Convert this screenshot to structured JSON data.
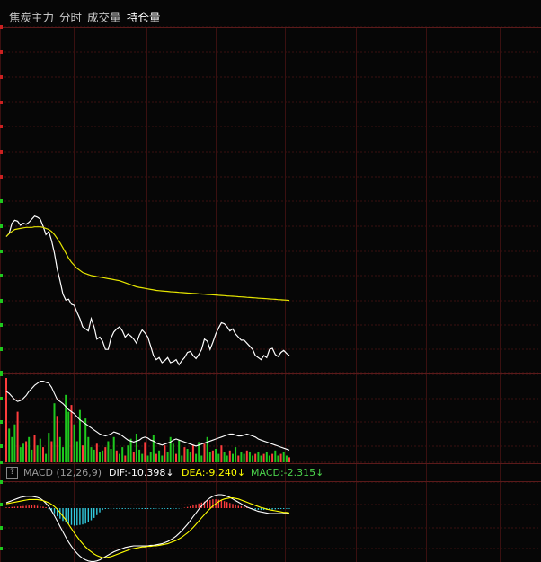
{
  "tabs": [
    {
      "label": "焦炭主力",
      "active": false
    },
    {
      "label": "分时",
      "active": false
    },
    {
      "label": "成交量",
      "active": false
    },
    {
      "label": "持仓量",
      "active": true
    }
  ],
  "macd_legend": {
    "help": "?",
    "title": "MACD (12,26,9)",
    "dif": "DIF:-10.398↓",
    "dea": "DEA:-9.240↓",
    "macd": "MACD:-2.315↓"
  },
  "colors": {
    "price": "#ffffff",
    "avg": "#e6e600",
    "up": "#ff3c3c",
    "down": "#1ec81e",
    "neg": "#32c8dc",
    "grid": "#3a1010",
    "dea": "#ffff00",
    "macd_label": "#4cd44c",
    "dea_label": "#ffff00",
    "dif_label": "#ffffff"
  },
  "chart_data": [
    {
      "type": "line",
      "panel": "price",
      "ylim": [
        0,
        100
      ],
      "series": [
        {
          "values": [
            60,
            63,
            73,
            76,
            75,
            71,
            73,
            72,
            74,
            77,
            80,
            79,
            77,
            70,
            62,
            65,
            56,
            44,
            28,
            17,
            4,
            -2,
            -1,
            -6,
            -7,
            -14,
            -20,
            -28,
            -30,
            -32,
            -20,
            -28,
            -40,
            -38,
            -42,
            -50,
            -50,
            -39,
            -33,
            -30,
            -28,
            -32,
            -38,
            -35,
            -37,
            -40,
            -44,
            -36,
            -31,
            -34,
            -38,
            -47,
            -56,
            -60,
            -58,
            -63,
            -61,
            -58,
            -63,
            -62,
            -60,
            -65,
            -61,
            -58,
            -53,
            -52,
            -56,
            -59,
            -55,
            -50,
            -40,
            -42,
            -50,
            -43,
            -35,
            -29,
            -24,
            -25,
            -28,
            -32,
            -30,
            -35,
            -38,
            -41,
            -41,
            -44,
            -47,
            -50,
            -56,
            -58,
            -60,
            -56,
            -58,
            -50,
            -49,
            -55,
            -57,
            -53,
            -51,
            -54,
            -56
          ]
        },
        {
          "values": [
            60,
            63,
            65,
            67,
            67.5,
            68,
            68.5,
            69,
            69,
            69,
            69.5,
            69.5,
            69.5,
            69,
            68,
            67,
            65,
            62,
            58,
            54,
            49,
            44,
            39,
            35,
            32,
            29,
            27,
            25,
            24,
            23,
            22,
            21.5,
            21,
            20.5,
            20,
            19.5,
            19,
            18.5,
            18,
            17.5,
            17,
            16,
            15,
            14,
            13,
            12,
            11,
            10.5,
            10,
            9.5,
            9,
            8.5,
            8,
            7.5,
            7.2,
            7,
            6.7,
            6.5,
            6.2,
            6,
            5.8,
            5.6,
            5.4,
            5.2,
            5,
            4.8,
            4.6,
            4.4,
            4.2,
            4,
            3.8,
            3.6,
            3.4,
            3.2,
            3,
            2.8,
            2.6,
            2.4,
            2.2,
            2,
            1.8,
            1.6,
            1.4,
            1.2,
            1,
            0.8,
            0.6,
            0.4,
            0.2,
            0,
            -0.2,
            -0.4,
            -0.6,
            -0.8,
            -1,
            -1.2,
            -1.4,
            -1.6,
            -1.8,
            -2,
            -2.2
          ]
        }
      ]
    },
    {
      "type": "bar",
      "panel": "volume",
      "ylim": [
        0,
        100
      ],
      "values": [
        100,
        40,
        30,
        45,
        60,
        18,
        22,
        25,
        30,
        15,
        32,
        20,
        28,
        18,
        10,
        35,
        25,
        70,
        55,
        30,
        18,
        80,
        60,
        68,
        45,
        25,
        62,
        20,
        52,
        30,
        18,
        15,
        22,
        12,
        14,
        18,
        25,
        16,
        30,
        14,
        10,
        18,
        8,
        20,
        28,
        12,
        34,
        15,
        10,
        24,
        8,
        12,
        32,
        10,
        14,
        8,
        20,
        12,
        30,
        22,
        10,
        26,
        8,
        18,
        16,
        12,
        20,
        10,
        24,
        8,
        22,
        30,
        12,
        14,
        16,
        10,
        20,
        12,
        8,
        14,
        10,
        18,
        8,
        12,
        10,
        14,
        12,
        8,
        10,
        12,
        8,
        10,
        12,
        8,
        10,
        14,
        8,
        10,
        12,
        8,
        6
      ],
      "up_flags": [
        1,
        0,
        0,
        0,
        1,
        0,
        0,
        1,
        0,
        0,
        1,
        0,
        0,
        1,
        0,
        0,
        1,
        0,
        1,
        0,
        0,
        0,
        0,
        1,
        0,
        0,
        0,
        1,
        0,
        0,
        0,
        0,
        1,
        0,
        0,
        1,
        0,
        0,
        0,
        1,
        0,
        0,
        1,
        0,
        0,
        1,
        0,
        0,
        0,
        1,
        0,
        0,
        0,
        1,
        0,
        0,
        1,
        0,
        0,
        0,
        1,
        0,
        0,
        1,
        0,
        0,
        1,
        0,
        0,
        0,
        1,
        0,
        0,
        1,
        0,
        0,
        1,
        0,
        0,
        1,
        0,
        0,
        1,
        0,
        0,
        1,
        0,
        0,
        1,
        0,
        0,
        1,
        0,
        0,
        1,
        0,
        0,
        1,
        0,
        0,
        1
      ]
    },
    {
      "type": "line",
      "panel": "open_interest",
      "ylim": [
        0,
        100
      ],
      "series": [
        {
          "values": [
            70,
            68,
            65,
            62,
            60,
            61,
            63,
            66,
            70,
            73,
            76,
            78,
            80,
            80,
            79,
            78,
            74,
            68,
            62,
            60,
            58,
            55,
            52,
            50,
            48,
            45,
            42,
            40,
            38,
            36,
            34,
            32,
            30,
            28,
            27,
            26,
            27,
            28,
            30,
            29,
            28,
            26,
            24,
            22,
            21,
            20,
            21,
            22,
            24,
            25,
            24,
            22,
            21,
            19,
            18,
            17,
            18,
            19,
            20,
            22,
            23,
            22,
            21,
            20,
            19,
            18,
            17,
            16,
            17,
            18,
            19,
            20,
            21,
            22,
            23,
            24,
            25,
            26,
            27,
            28,
            28,
            27,
            26,
            26,
            27,
            28,
            27,
            26,
            25,
            23,
            22,
            21,
            20,
            19,
            18,
            17,
            16,
            15,
            14,
            13,
            12
          ]
        }
      ]
    },
    {
      "type": "bar",
      "panel": "macd",
      "ylim": [
        -100,
        100
      ],
      "values": [
        3,
        4,
        5,
        6,
        7,
        8,
        9,
        10,
        11,
        12,
        11,
        10,
        8,
        6,
        4,
        -5,
        -12,
        -22,
        -35,
        -45,
        -55,
        -62,
        -68,
        -72,
        -75,
        -74,
        -72,
        -70,
        -66,
        -60,
        -52,
        -42,
        -30,
        -18,
        -8,
        -4,
        -3,
        -2,
        -2,
        -3,
        -4,
        -4,
        -3,
        -3,
        -2,
        -2,
        -3,
        -3,
        -4,
        -4,
        -4,
        -3,
        -3,
        -2,
        -2,
        -3,
        -3,
        -4,
        -4,
        -3,
        -3,
        -2,
        -1,
        2,
        5,
        8,
        12,
        16,
        20,
        24,
        28,
        32,
        35,
        38,
        38,
        36,
        33,
        30,
        26,
        22,
        18,
        14,
        10,
        8,
        6,
        4,
        -2,
        -4,
        -6,
        -7,
        -8,
        -8,
        -7,
        -6,
        -6,
        -5,
        -4,
        -4,
        -4,
        -3,
        -3
      ]
    },
    {
      "type": "line",
      "panel": "macd_lines",
      "ylim": [
        -100,
        100
      ],
      "series": [
        {
          "values": [
            10,
            12,
            14,
            16,
            18,
            20,
            21,
            22,
            22,
            22,
            21,
            20,
            18,
            14,
            9,
            3,
            -5,
            -14,
            -24,
            -34,
            -44,
            -54,
            -63,
            -71,
            -78,
            -84,
            -89,
            -93,
            -96,
            -98,
            -99,
            -99,
            -98,
            -96,
            -93,
            -90,
            -87,
            -84,
            -81,
            -79,
            -77,
            -75,
            -73,
            -72,
            -71,
            -70,
            -70,
            -70,
            -70,
            -70,
            -70,
            -69,
            -69,
            -68,
            -67,
            -66,
            -64,
            -62,
            -59,
            -56,
            -52,
            -47,
            -42,
            -36,
            -30,
            -23,
            -16,
            -9,
            -2,
            4,
            10,
            15,
            19,
            22,
            24,
            25,
            25,
            24,
            22,
            20,
            17,
            14,
            11,
            8,
            5,
            2,
            0,
            -2,
            -4,
            -6,
            -7,
            -8,
            -9,
            -10,
            -10,
            -10,
            -10,
            -10,
            -10,
            -10,
            -10
          ]
        },
        {
          "values": [
            8,
            9,
            10,
            11,
            12,
            13,
            14,
            15,
            16,
            16,
            16,
            16,
            15,
            14,
            12,
            10,
            7,
            3,
            -2,
            -8,
            -15,
            -22,
            -30,
            -38,
            -46,
            -53,
            -60,
            -66,
            -72,
            -77,
            -81,
            -85,
            -88,
            -90,
            -92,
            -92,
            -91,
            -90,
            -88,
            -86,
            -84,
            -82,
            -80,
            -78,
            -76,
            -75,
            -74,
            -73,
            -72,
            -72,
            -71,
            -71,
            -70,
            -70,
            -69,
            -68,
            -67,
            -66,
            -64,
            -62,
            -60,
            -57,
            -54,
            -50,
            -46,
            -41,
            -36,
            -30,
            -24,
            -18,
            -12,
            -6,
            -1,
            4,
            8,
            12,
            15,
            17,
            18,
            19,
            19,
            18,
            17,
            15,
            13,
            11,
            9,
            7,
            5,
            3,
            1,
            0,
            -2,
            -3,
            -4,
            -5,
            -6,
            -7,
            -8,
            -8,
            -9
          ]
        }
      ]
    }
  ]
}
